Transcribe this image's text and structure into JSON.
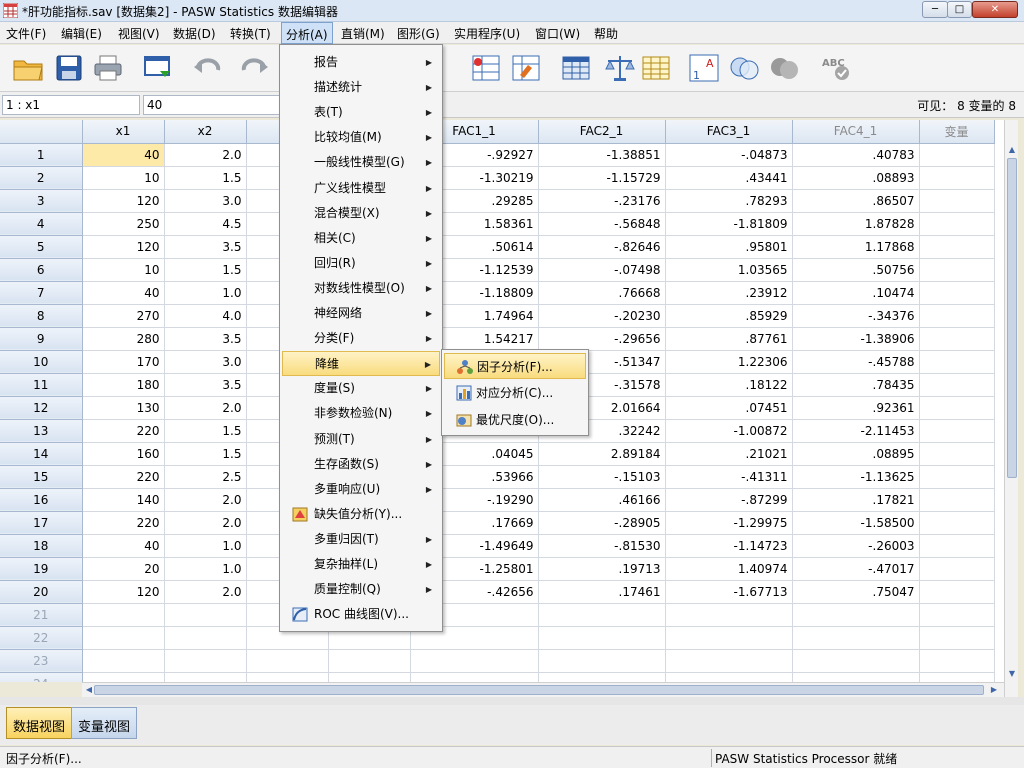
{
  "window": {
    "title": "*肝功能指标.sav [数据集2] - PASW Statistics 数据编辑器",
    "minimize": "─",
    "maximize": "□",
    "close": "✕"
  },
  "menubar": {
    "items": [
      "文件(F)",
      "编辑(E)",
      "视图(V)",
      "数据(D)",
      "转换(T)",
      "分析(A)",
      "直销(M)",
      "图形(G)",
      "实用程序(U)",
      "窗口(W)",
      "帮助"
    ]
  },
  "toolbar": {
    "icons": [
      "open-folder-icon",
      "save-icon",
      "print-icon",
      "recall-dialog-icon",
      "undo-icon",
      "redo-icon",
      "insert-cases-icon",
      "select-cases-icon",
      "data-table-icon",
      "balance-weight-icon",
      "table-grid-icon",
      "value-labels-icon",
      "circles-icon",
      "gray-circles-icon",
      "spell-check-icon"
    ]
  },
  "refbar": {
    "cell_ref": "1 : x1",
    "cell_value": "40",
    "visible": "可见： 8 变量的 8"
  },
  "grid": {
    "columns": [
      "x1",
      "x2",
      "",
      "",
      "FAC1_1",
      "FAC2_1",
      "FAC3_1",
      "FAC4_1",
      "变量"
    ],
    "rows": [
      [
        "40",
        "2.0",
        "-.92927",
        "-1.38851",
        "-.04873",
        ".40783"
      ],
      [
        "10",
        "1.5",
        "-1.30219",
        "-1.15729",
        ".43441",
        ".08893"
      ],
      [
        "120",
        "3.0",
        ".29285",
        "-.23176",
        ".78293",
        ".86507"
      ],
      [
        "250",
        "4.5",
        "1.58361",
        "-.56848",
        "-1.81809",
        "1.87828"
      ],
      [
        "120",
        "3.5",
        ".50614",
        "-.82646",
        ".95801",
        "1.17868"
      ],
      [
        "10",
        "1.5",
        "-1.12539",
        "-.07498",
        "1.03565",
        ".50756"
      ],
      [
        "40",
        "1.0",
        "-1.18809",
        ".76668",
        ".23912",
        ".10474"
      ],
      [
        "270",
        "4.0",
        "1.74964",
        "-.20230",
        ".85929",
        "-.34376"
      ],
      [
        "280",
        "3.5",
        "1.54217",
        "-.29656",
        ".87761",
        "-1.38906"
      ],
      [
        "170",
        "3.0",
        "",
        "-.51347",
        "1.22306",
        "-.45788"
      ],
      [
        "180",
        "3.5",
        "",
        "-.31578",
        ".18122",
        ".78435"
      ],
      [
        "130",
        "2.0",
        "",
        "2.01664",
        ".07451",
        ".92361"
      ],
      [
        "220",
        "1.5",
        "",
        ".32242",
        "-1.00872",
        "-2.11453"
      ],
      [
        "160",
        "1.5",
        ".04045",
        "2.89184",
        ".21021",
        ".08895"
      ],
      [
        "220",
        "2.5",
        ".53966",
        "-.15103",
        "-.41311",
        "-1.13625"
      ],
      [
        "140",
        "2.0",
        "-.19290",
        ".46166",
        "-.87299",
        ".17821"
      ],
      [
        "220",
        "2.0",
        ".17669",
        "-.28905",
        "-1.29975",
        "-1.58500"
      ],
      [
        "40",
        "1.0",
        "-1.49649",
        "-.81530",
        "-1.14723",
        "-.26003"
      ],
      [
        "20",
        "1.0",
        "-1.25801",
        ".19713",
        "1.40974",
        "-.47017"
      ],
      [
        "120",
        "2.0",
        "-.42656",
        ".17461",
        "-1.67713",
        ".75047"
      ]
    ],
    "empty_rows": [
      "21",
      "22",
      "23",
      "24"
    ]
  },
  "analyze_menu": {
    "items": [
      {
        "label": "报告",
        "arrow": true
      },
      {
        "label": "描述统计",
        "arrow": true
      },
      {
        "label": "表(T)",
        "arrow": true
      },
      {
        "label": "比较均值(M)",
        "arrow": true
      },
      {
        "label": "一般线性模型(G)",
        "arrow": true
      },
      {
        "label": "广义线性模型",
        "arrow": true
      },
      {
        "label": "混合模型(X)",
        "arrow": true
      },
      {
        "label": "相关(C)",
        "arrow": true
      },
      {
        "label": "回归(R)",
        "arrow": true
      },
      {
        "label": "对数线性模型(O)",
        "arrow": true
      },
      {
        "label": "神经网络",
        "arrow": true
      },
      {
        "label": "分类(F)",
        "arrow": true
      },
      {
        "label": "降维",
        "arrow": true
      },
      {
        "label": "度量(S)",
        "arrow": true
      },
      {
        "label": "非参数检验(N)",
        "arrow": true
      },
      {
        "label": "预测(T)",
        "arrow": true
      },
      {
        "label": "生存函数(S)",
        "arrow": true
      },
      {
        "label": "多重响应(U)",
        "arrow": true
      },
      {
        "label": "缺失值分析(Y)...",
        "arrow": false
      },
      {
        "label": "多重归因(T)",
        "arrow": true
      },
      {
        "label": "复杂抽样(L)",
        "arrow": true
      },
      {
        "label": "质量控制(Q)",
        "arrow": true
      },
      {
        "label": "ROC 曲线图(V)...",
        "arrow": false
      }
    ]
  },
  "dimension_submenu": {
    "items": [
      "因子分析(F)...",
      "对应分析(C)...",
      "最优尺度(O)..."
    ]
  },
  "tabs": {
    "data_view": "数据视图",
    "variable_view": "变量视图"
  },
  "status": {
    "left": "因子分析(F)...",
    "right": "PASW Statistics Processor 就绪"
  },
  "colors": {
    "highlight": "#f9dc7e",
    "selected_cell": "#fde9a8",
    "header_blue": "#dce6f2"
  }
}
